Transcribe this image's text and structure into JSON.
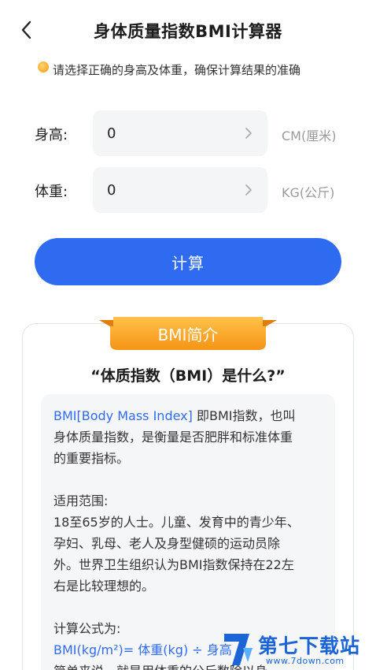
{
  "header": {
    "back_icon": "chevron-left-icon",
    "title": "身体质量指数BMI计算器"
  },
  "hint": {
    "icon": "bulb-icon",
    "text": "请选择正确的身高及体重，确保计算结果的准确"
  },
  "form": {
    "height": {
      "label": "身高:",
      "value": "0",
      "unit": "CM(厘米)"
    },
    "weight": {
      "label": "体重:",
      "value": "0",
      "unit": "KG(公斤)"
    },
    "calc_label": "计算"
  },
  "card": {
    "ribbon": "BMI简介",
    "question": "“体质指数（BMI）是什么?”",
    "intro_highlight": "BMI[Body Mass Index]",
    "intro_line1_rest": " 即BMI指数，也叫",
    "intro_line2": "身体质量指数，是衡量是否肥胖和标准体重",
    "intro_line3": "的重要指标。",
    "scope_title": "适用范围:",
    "scope_line1": "18至65岁的人士。儿童、发育中的青少年、",
    "scope_line2": "孕妇、乳母、老人及身型健硕的运动员除",
    "scope_line3": "外。世界卫生组织认为BMI指数保持在22左",
    "scope_line4": "右是比较理想的。",
    "formula_title": "计算公式为:",
    "formula": "BMI(kg/m²)= 体重(kg) ÷ 身高",
    "simple_line": "简单来说，就是用体重的公斤数除以身"
  },
  "watermark": {
    "text": "第七下载站",
    "url": "www.7down.com"
  },
  "colors": {
    "primary": "#2f6bf1",
    "ribbon": "#f7a21b",
    "field_bg": "#f4f5f7"
  }
}
